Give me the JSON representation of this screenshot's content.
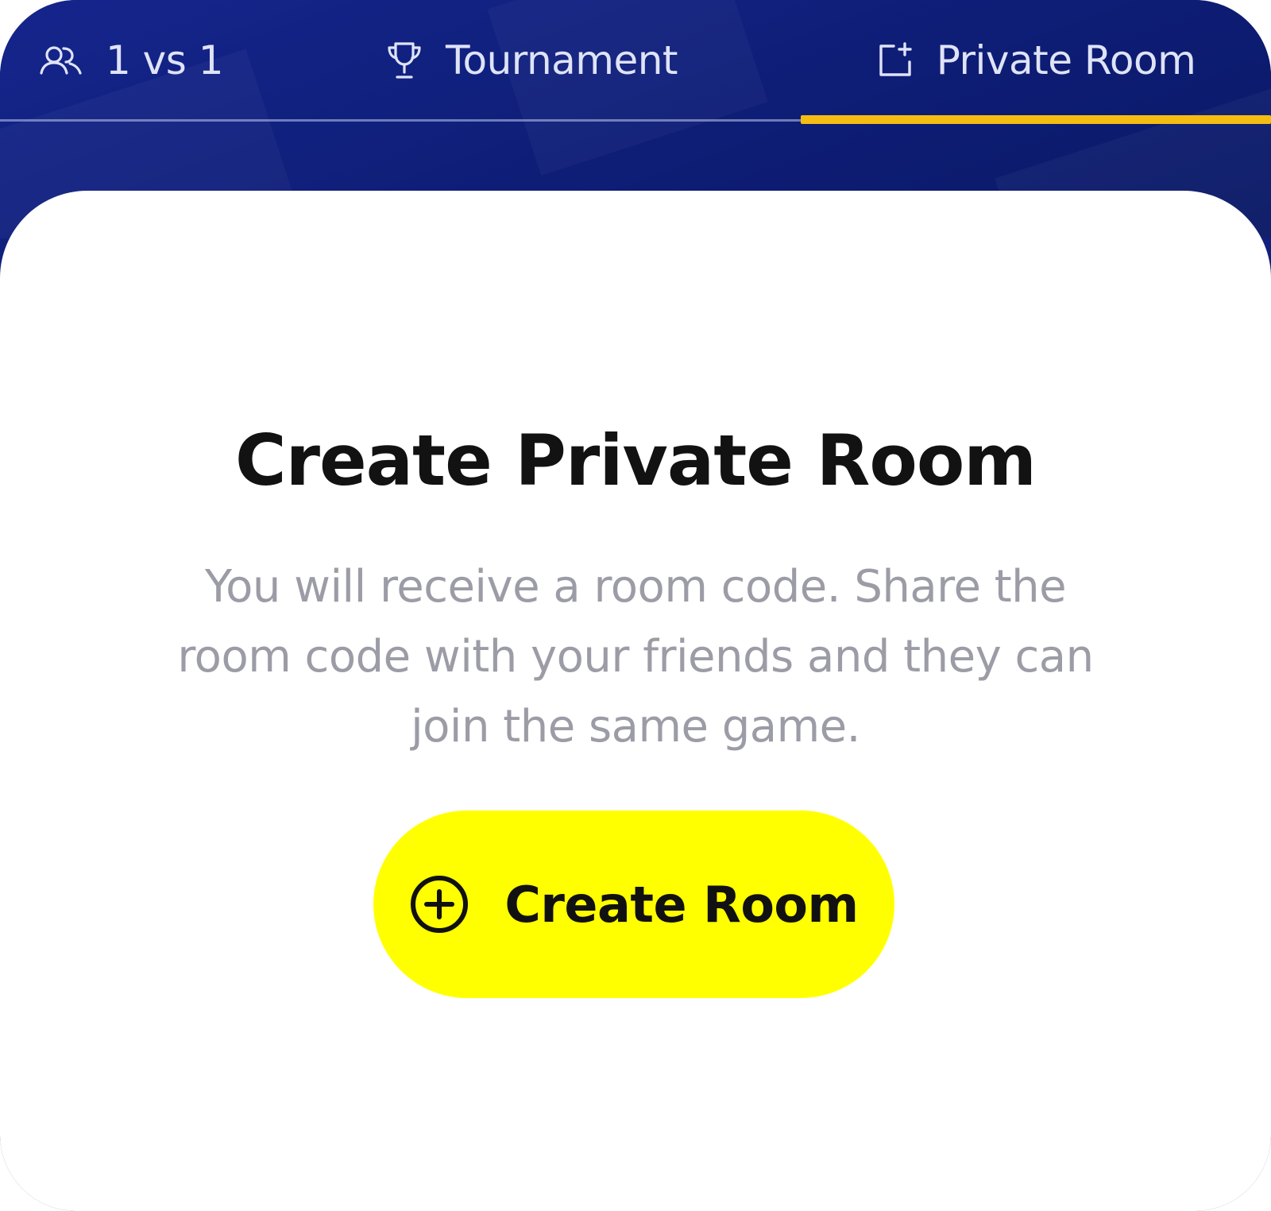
{
  "tabs": [
    {
      "label": "1 vs 1",
      "icon": "users-icon",
      "active": false
    },
    {
      "label": "Tournament",
      "icon": "trophy-icon",
      "active": false
    },
    {
      "label": "Private Room",
      "icon": "add-room-icon",
      "active": true
    }
  ],
  "main": {
    "title": "Create Private Room",
    "description": "You will receive a room code. Share the room code with your friends and they can join the same game.",
    "create_button": {
      "label": "Create Room",
      "icon": "plus-circle-icon"
    }
  },
  "colors": {
    "header_bg": "#10207d",
    "active_tab_underline": "#f5bd12",
    "button_bg": "#ffff00",
    "title_text": "#121212",
    "description_text": "#9c9ca6"
  }
}
